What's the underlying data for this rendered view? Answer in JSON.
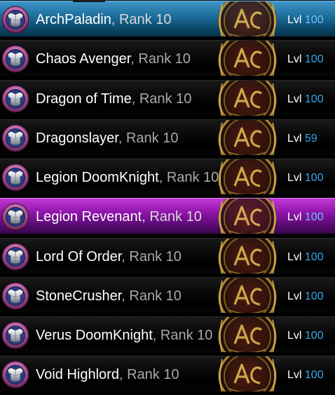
{
  "colors": {
    "selected_row": "#1e6f9c",
    "highlighted_row": "#8e14aa",
    "level_value": "#36a6e8",
    "rank_text": "#a9a9a9",
    "emblem_gold": "#c9a13a"
  },
  "icons": {
    "badge": "armor-badge-icon",
    "emblem": "ac-emblem-icon"
  },
  "classes": [
    {
      "name": "ArchPaladin",
      "sep": ",",
      "rank": "Rank 10",
      "lvl_label": "Lvl",
      "lvl_value": "100",
      "state": "selected"
    },
    {
      "name": "Chaos Avenger",
      "sep": ",",
      "rank": "Rank 10",
      "lvl_label": "Lvl",
      "lvl_value": "100",
      "state": "normal"
    },
    {
      "name": "Dragon of Time",
      "sep": ",",
      "rank": "Rank 10",
      "lvl_label": "Lvl",
      "lvl_value": "100",
      "state": "normal"
    },
    {
      "name": "Dragonslayer",
      "sep": ",",
      "rank": "Rank 10",
      "lvl_label": "Lvl",
      "lvl_value": "59",
      "state": "normal"
    },
    {
      "name": "Legion DoomKnight",
      "sep": ",",
      "rank": "Rank 10",
      "lvl_label": "Lvl",
      "lvl_value": "100",
      "state": "normal"
    },
    {
      "name": "Legion Revenant",
      "sep": ",",
      "rank": "Rank 10",
      "lvl_label": "Lvl",
      "lvl_value": "100",
      "state": "highlighted"
    },
    {
      "name": "Lord Of Order",
      "sep": ",",
      "rank": "Rank 10",
      "lvl_label": "Lvl",
      "lvl_value": "100",
      "state": "normal"
    },
    {
      "name": "StoneCrusher",
      "sep": ",",
      "rank": "Rank 10",
      "lvl_label": "Lvl",
      "lvl_value": "100",
      "state": "normal"
    },
    {
      "name": "Verus DoomKnight",
      "sep": ",",
      "rank": "Rank 10",
      "lvl_label": "Lvl",
      "lvl_value": "100",
      "state": "normal"
    },
    {
      "name": "Void Highlord",
      "sep": ",",
      "rank": "Rank 10",
      "lvl_label": "Lvl",
      "lvl_value": "100",
      "state": "normal"
    }
  ]
}
